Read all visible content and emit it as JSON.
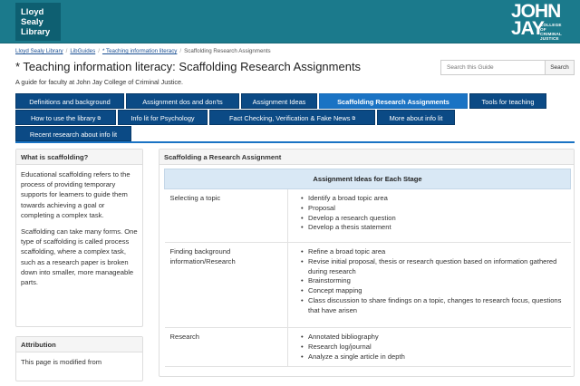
{
  "header": {
    "logo_left_lines": [
      "Lloyd",
      "Sealy",
      "Library"
    ],
    "logo_right_word1": "JOHN",
    "logo_right_word2": "JAY",
    "logo_right_sub": [
      "COLLEGE",
      "OF",
      "CRIMINAL",
      "JUSTICE"
    ]
  },
  "breadcrumb": {
    "items": [
      "Lloyd Sealy Library",
      "LibGuides",
      "* Teaching information literacy",
      "Scaffolding Research Assignments"
    ],
    "separator": "/"
  },
  "page": {
    "title": "* Teaching information literacy: Scaffolding Research Assignments",
    "subtitle": "A guide for faculty at John Jay College of Criminal Justice."
  },
  "search": {
    "placeholder": "Search this Guide",
    "button_label": "Search"
  },
  "tabs": [
    {
      "label": "Definitions and background"
    },
    {
      "label": "Assignment dos and don'ts"
    },
    {
      "label": "Assignment Ideas"
    },
    {
      "label": "Scaffolding Research Assignments",
      "active": true
    },
    {
      "label": "Tools for teaching"
    },
    {
      "label": "How to use the library",
      "external": true
    },
    {
      "label": "Info lit for Psychology"
    },
    {
      "label": "Fact Checking, Verification & Fake News",
      "external": true
    },
    {
      "label": "More about info lit"
    },
    {
      "label": "Recent research about info lit"
    }
  ],
  "sidebar": {
    "what": {
      "title": "What is scaffolding?",
      "paragraphs": [
        "Educational scaffolding refers to the process of providing temporary supports for learners to guide them towards achieving a goal or completing a complex task.",
        "Scaffolding can take many forms. One type of scaffolding is called process scaffolding, where a complex task, such as a research paper is broken down into smaller, more manageable parts."
      ]
    },
    "attribution": {
      "title": "Attribution",
      "text": "This page is modified from"
    }
  },
  "main": {
    "title": "Scaffolding a Research Assignment",
    "table_header": "Assignment Ideas for Each Stage",
    "rows": [
      {
        "stage": "Selecting a topic",
        "ideas": [
          "Identify a broad topic area",
          "Proposal",
          "Develop a research question",
          "Develop a thesis statement"
        ]
      },
      {
        "stage": "Finding background information/Research",
        "ideas": [
          "Refine a broad topic area",
          "Revise initial proposal, thesis or research question based on information gathered during research",
          "Brainstorming",
          "Concept mapping",
          "Class discussion to share findings on a topic, changes to research focus, questions that have arisen"
        ]
      },
      {
        "stage": "Research",
        "ideas": [
          "Annotated bibliography",
          "Research log/journal",
          "Analyze a single article in depth"
        ]
      }
    ]
  },
  "colors": {
    "banner": "#1b7a8c",
    "tab": "#0b4a85",
    "tab_active": "#1a73c4",
    "table_header": "#d9e8f5"
  }
}
